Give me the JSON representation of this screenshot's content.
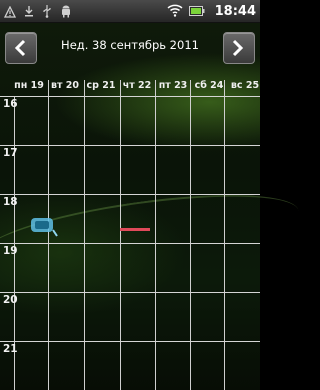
{
  "status_bar": {
    "time": "18:44",
    "left_icons": [
      "warning-icon",
      "download-icon",
      "usb-icon",
      "android-debug-icon"
    ],
    "right_icons": [
      "wifi-icon",
      "battery-icon"
    ]
  },
  "header": {
    "title": "Нед. 38 сентябрь 2011",
    "prev_icon": "chevron-left-icon",
    "next_icon": "chevron-right-icon"
  },
  "days": [
    "пн 19",
    "вт 20",
    "ср 21",
    "чт 22",
    "пт 23",
    "сб 24",
    "вс 25"
  ],
  "hours": [
    "16",
    "17",
    "18",
    "19",
    "20",
    "21"
  ],
  "event": {
    "day": "чт 22",
    "hour": "18",
    "color": "#e04a5a"
  },
  "colors": {
    "grid": "#cfcfcf",
    "event": "#e04a5a"
  }
}
